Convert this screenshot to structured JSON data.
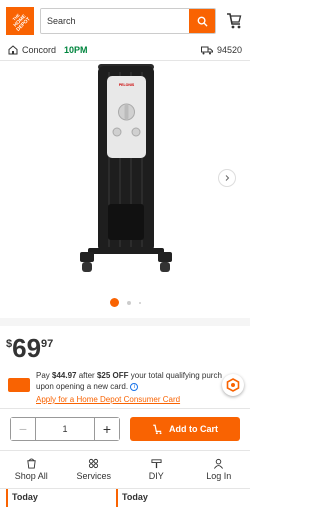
{
  "header": {
    "logo_icon": "home-depot-logo",
    "search_placeholder": "Search",
    "search_icon": "search-icon",
    "cart_icon": "cart-icon"
  },
  "store": {
    "name": "Concord",
    "time": "10PM",
    "zip": "94520"
  },
  "gallery": {
    "product": "oil-filled radiant heater (black)",
    "brand_label": "PELONIS",
    "dots": 3,
    "active_dot": 0
  },
  "price": {
    "dollar": "$",
    "whole": "69",
    "cents": "97"
  },
  "promo": {
    "prefix": "Pay ",
    "amount": "$44.97",
    "middle": " after ",
    "discount": "$25 OFF",
    "suffix": " your total qualifying purch",
    "line2": "upon opening a new card.",
    "link": "Apply for a Home Depot Consumer Card"
  },
  "buy": {
    "quantity": "1",
    "minus": "−",
    "plus": "+",
    "add_to_cart": "Add to Cart"
  },
  "nav": [
    {
      "label": "Shop All",
      "icon": "shop-all-icon"
    },
    {
      "label": "Services",
      "icon": "services-icon"
    },
    {
      "label": "DIY",
      "icon": "diy-icon"
    },
    {
      "label": "Log In",
      "icon": "user-icon"
    }
  ],
  "strip": [
    "Today",
    "Today"
  ],
  "colors": {
    "brand": "#f96302",
    "store_time": "#00853e"
  }
}
